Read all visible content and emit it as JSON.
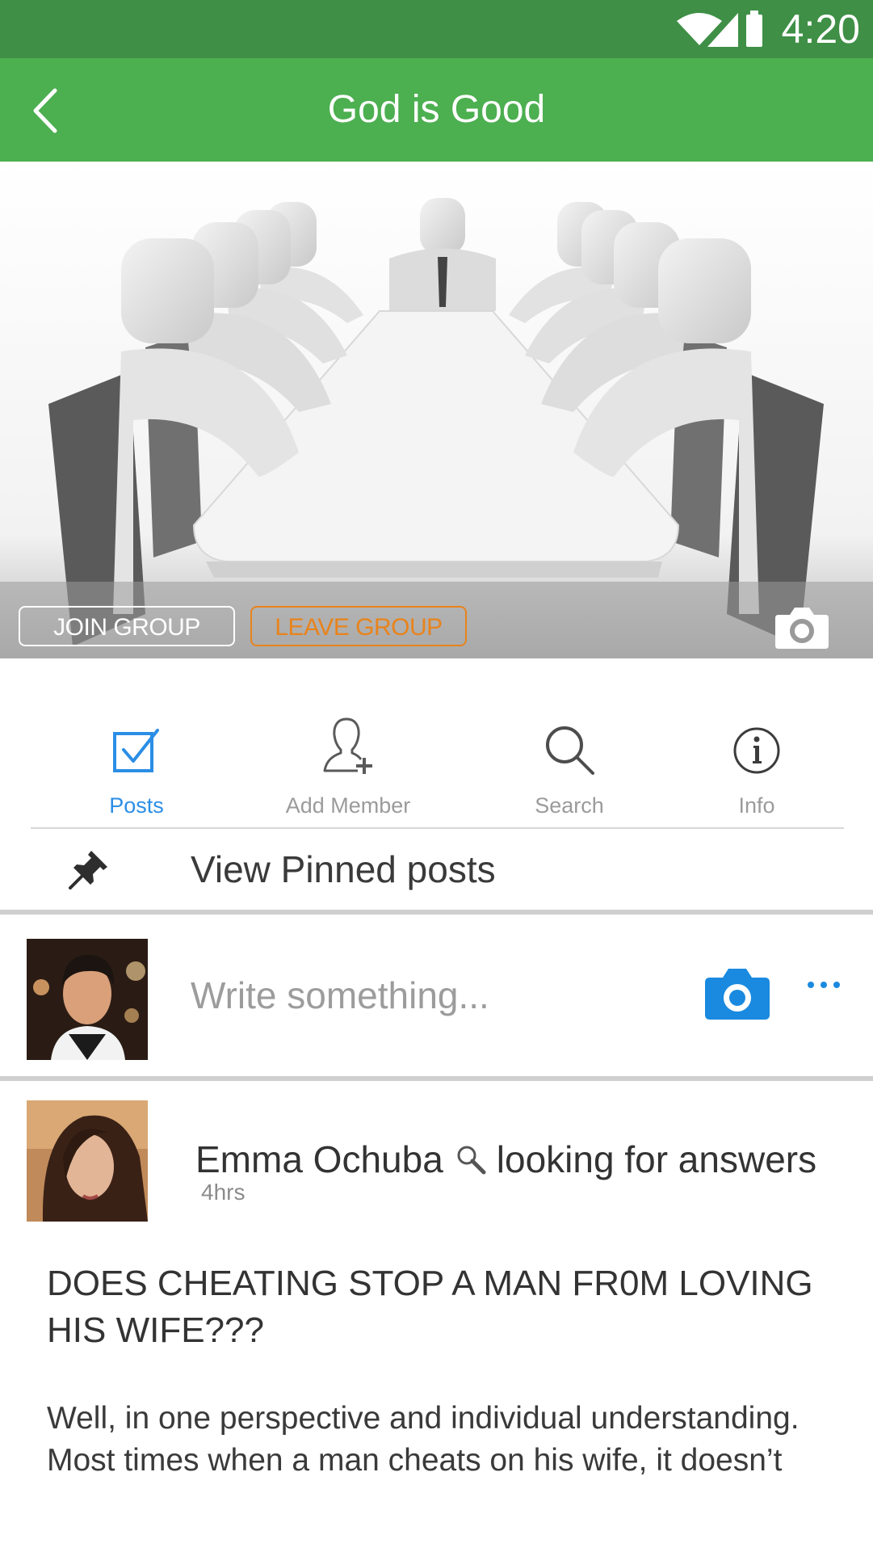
{
  "status_bar": {
    "time": "4:20",
    "icons": [
      "wifi-icon",
      "signal-icon",
      "battery-icon"
    ]
  },
  "header": {
    "title": "God is Good",
    "back_icon": "chevron-left-icon"
  },
  "cover": {
    "image": "conference-table-photo",
    "join_label": "JOIN GROUP",
    "leave_label": "LEAVE GROUP",
    "camera_icon": "camera-icon"
  },
  "tabs": [
    {
      "label": "Posts",
      "icon": "checkbox-icon",
      "active": true
    },
    {
      "label": "Add Member",
      "icon": "add-member-icon",
      "active": false
    },
    {
      "label": "Search",
      "icon": "search-icon",
      "active": false
    },
    {
      "label": "Info",
      "icon": "info-icon",
      "active": false
    }
  ],
  "pinned": {
    "label": "View Pinned posts",
    "icon": "pin-icon"
  },
  "composer": {
    "placeholder": "Write something...",
    "camera_icon": "camera-icon",
    "more_icon": "more-icon"
  },
  "post": {
    "author": "Emma Ochuba",
    "activity": "looking for answers",
    "activity_icon": "magnifier-icon",
    "time": "4hrs",
    "title": "DOES CHEATING STOP A MAN FR0M LOVING HIS WIFE???",
    "body": "Well, in one perspective and individual understanding. Most times when a man cheats on his wife, it doesn’t"
  },
  "colors": {
    "status_bar": "#3f8f46",
    "app_bar": "#4caf50",
    "active_tab": "#2b8ee6",
    "leave_button": "#e9831b",
    "separator": "#cfcfcf"
  }
}
